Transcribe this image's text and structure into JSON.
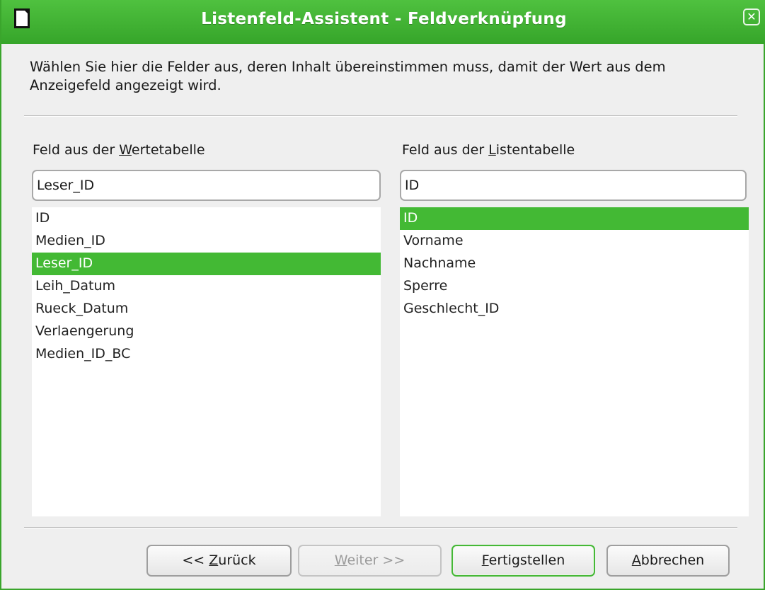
{
  "window": {
    "title": "Listenfeld-Assistent - Feldverknüpfung",
    "close_glyph": "✕",
    "accent_color": "#43b934"
  },
  "description": "Wählen Sie hier die Felder aus, deren Inhalt übereinstimmen muss, damit der Wert aus dem Anzeigefeld angezeigt wird.",
  "left": {
    "label_pre": "Feld aus der ",
    "label_mnemonic": "W",
    "label_post": "ertetabelle",
    "value": "Leser_ID",
    "items": [
      "ID",
      "Medien_ID",
      "Leser_ID",
      "Leih_Datum",
      "Rueck_Datum",
      "Verlaengerung",
      "Medien_ID_BC"
    ],
    "selected_index": 2
  },
  "right": {
    "label_pre": "Feld aus der ",
    "label_mnemonic": "L",
    "label_post": "istentabelle",
    "value": "ID",
    "items": [
      "ID",
      "Vorname",
      "Nachname",
      "Sperre",
      "Geschlecht_ID"
    ],
    "selected_index": 0
  },
  "buttons": {
    "back": {
      "pre": "<< ",
      "mnemonic": "Z",
      "post": "urück"
    },
    "next": {
      "pre": "",
      "mnemonic": "W",
      "post": "eiter >>"
    },
    "finish": {
      "pre": "",
      "mnemonic": "F",
      "post": "ertigstellen"
    },
    "cancel": {
      "pre": "",
      "mnemonic": "A",
      "post": "bbrechen"
    }
  }
}
